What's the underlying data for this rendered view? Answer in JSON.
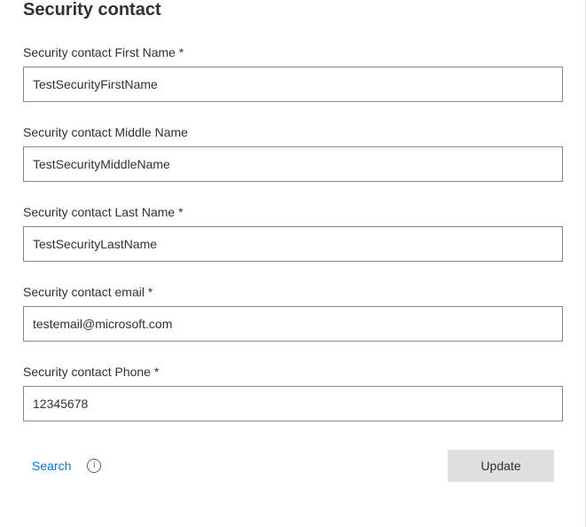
{
  "section": {
    "title": "Security contact"
  },
  "fields": {
    "firstName": {
      "label": "Security contact First Name",
      "value": "TestSecurityFirstName",
      "required": true
    },
    "middleName": {
      "label": "Security contact Middle Name",
      "value": "TestSecurityMiddleName",
      "required": false
    },
    "lastName": {
      "label": "Security contact Last Name",
      "value": "TestSecurityLastName",
      "required": true
    },
    "email": {
      "label": "Security contact email",
      "value": "testemail@microsoft.com",
      "required": true
    },
    "phone": {
      "label": "Security contact Phone",
      "value": "12345678",
      "required": true
    }
  },
  "footer": {
    "searchLabel": "Search",
    "infoGlyph": "i",
    "updateLabel": "Update"
  }
}
